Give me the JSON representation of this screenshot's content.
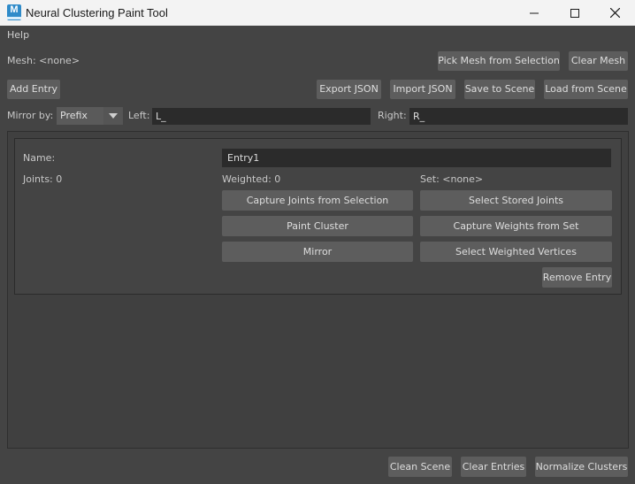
{
  "window": {
    "title": "Neural Clustering Paint Tool",
    "icon_letter": "M",
    "controls": [
      "minimize-icon",
      "maximize-icon",
      "close-icon"
    ]
  },
  "menu": {
    "help": "Help"
  },
  "mesh": {
    "label": "Mesh: <none>",
    "pick_button": "Pick Mesh from Selection",
    "clear_button": "Clear Mesh"
  },
  "toolbar": {
    "add_entry": "Add Entry",
    "export_json": "Export JSON",
    "import_json": "Import JSON",
    "save_to_scene": "Save to Scene",
    "load_from_scene": "Load from Scene"
  },
  "mirror": {
    "mirror_by_label": "Mirror by:",
    "mode_value": "Prefix",
    "left_label": "Left:",
    "left_value": "L_",
    "right_label": "Right:",
    "right_value": "R_"
  },
  "entry": {
    "name_label": "Name:",
    "name_value": "Entry1",
    "joints_label": "Joints: 0",
    "weighted_label": "Weighted: 0",
    "set_label": "Set: <none>",
    "capture_joints": "Capture Joints from Selection",
    "select_stored_joints": "Select Stored Joints",
    "paint_cluster": "Paint Cluster",
    "capture_weights": "Capture Weights from Set",
    "mirror": "Mirror",
    "select_weighted_vertices": "Select Weighted Vertices",
    "remove_entry": "Remove Entry"
  },
  "footer": {
    "clean_scene": "Clean Scene",
    "clear_entries": "Clear Entries",
    "normalize_clusters": "Normalize Clusters"
  },
  "colors": {
    "background": "#444444",
    "button": "#5d5d5d",
    "field": "#2b2b2b",
    "titlebar": "#f3f3f3",
    "app_icon": "#2f8bc9"
  }
}
